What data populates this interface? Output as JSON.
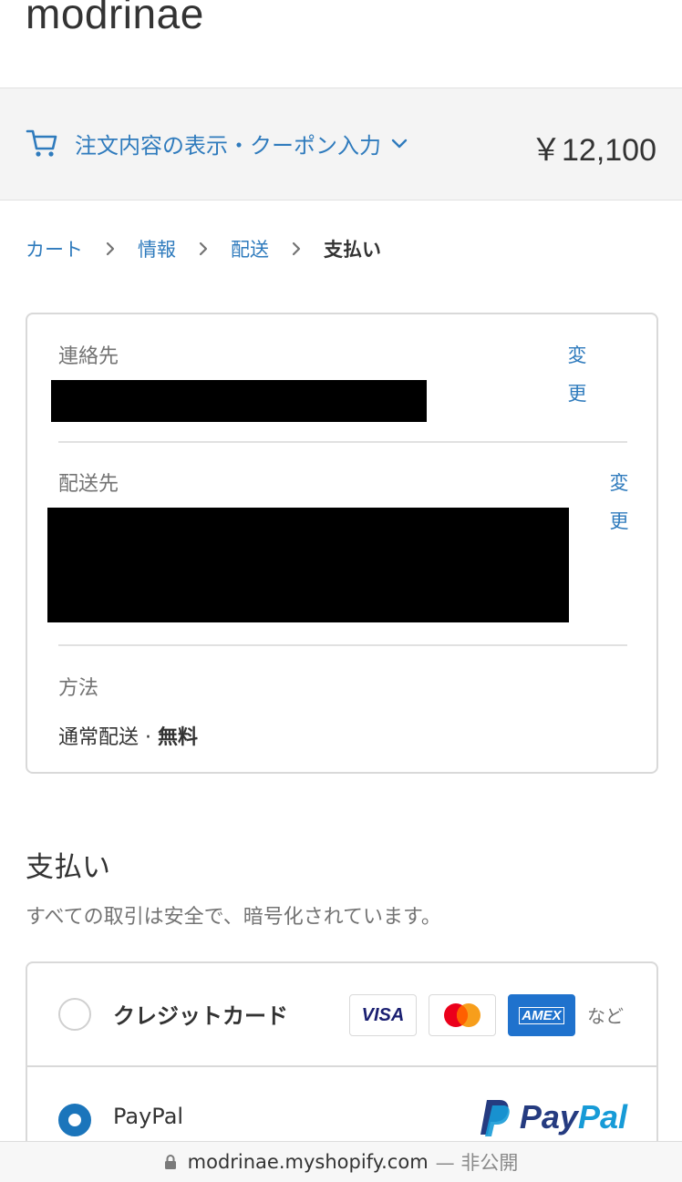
{
  "store": {
    "name": "modrinae"
  },
  "summary": {
    "toggle_label": "注文内容の表示・クーポン入力",
    "total": "￥12,100"
  },
  "breadcrumb": {
    "items": [
      "カート",
      "情報",
      "配送",
      "支払い"
    ]
  },
  "review": {
    "contact": {
      "label": "連絡先",
      "change": "変更"
    },
    "ship_to": {
      "label": "配送先",
      "change": "変更"
    },
    "method": {
      "label": "方法",
      "value": "通常配送 · ",
      "price": "無料"
    }
  },
  "payment": {
    "title": "支払い",
    "subtitle": "すべての取引は安全で、暗号化されています。",
    "options": [
      {
        "label": "クレジットカード",
        "selected": false
      },
      {
        "label": "PayPal",
        "selected": true
      }
    ],
    "card_brands": [
      "VISA",
      "mastercard",
      "AMEX"
    ],
    "more_label": "など",
    "paypal_logo": "PayPal"
  },
  "browser": {
    "url": "modrinae.myshopify.com",
    "visibility": "— 非公開"
  },
  "colors": {
    "link": "#2f7bbd",
    "radio_selected": "#1b75bb",
    "paypal_dark": "#253b80",
    "paypal_light": "#179bd7"
  },
  "icons": [
    "cart-icon",
    "chevron-down-icon",
    "chevron-right-icon",
    "lock-icon"
  ]
}
